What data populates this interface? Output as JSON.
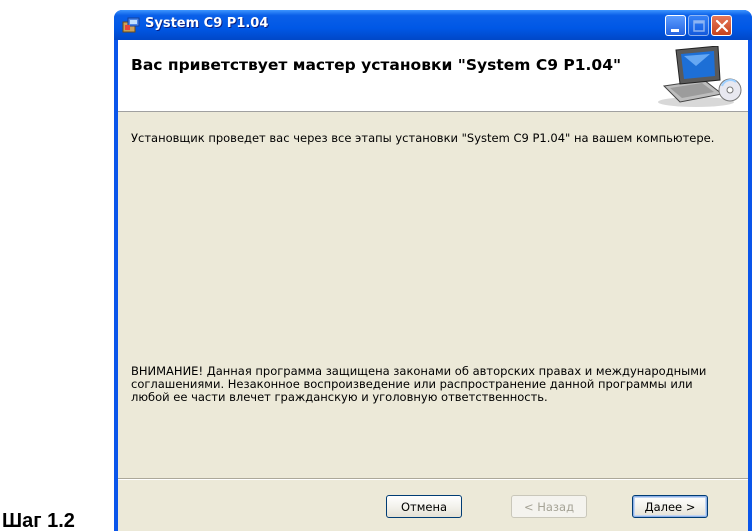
{
  "step_label": "Шаг 1.2",
  "window": {
    "title": "System C9 P1.04",
    "icon": "installer-box-icon",
    "controls": {
      "minimize_icon": "minimize-icon",
      "maximize_icon": "maximize-icon",
      "close_icon": "close-icon"
    }
  },
  "banner": {
    "title": "Вас приветствует мастер установки \"System C9 P1.04\"",
    "art_icon": "computer-setup-icon"
  },
  "content": {
    "intro": "Установщик проведет вас через все этапы установки \"System C9 P1.04\" на вашем компьютере.",
    "warning": "ВНИМАНИЕ! Данная программа защищена законами об авторских правах и международными соглашениями. Незаконное воспроизведение или распространение данной программы или любой ее части влечет гражданскую и уголовную ответственность."
  },
  "buttons": {
    "cancel": "Отмена",
    "back": "< Назад",
    "next": "Далее >"
  },
  "colors": {
    "titlebar": "#0058E6",
    "dialog_bg": "#ECE9D8",
    "banner_bg": "#FFFFFF",
    "close_button": "#C6421C",
    "disabled_text": "#A5A396"
  }
}
